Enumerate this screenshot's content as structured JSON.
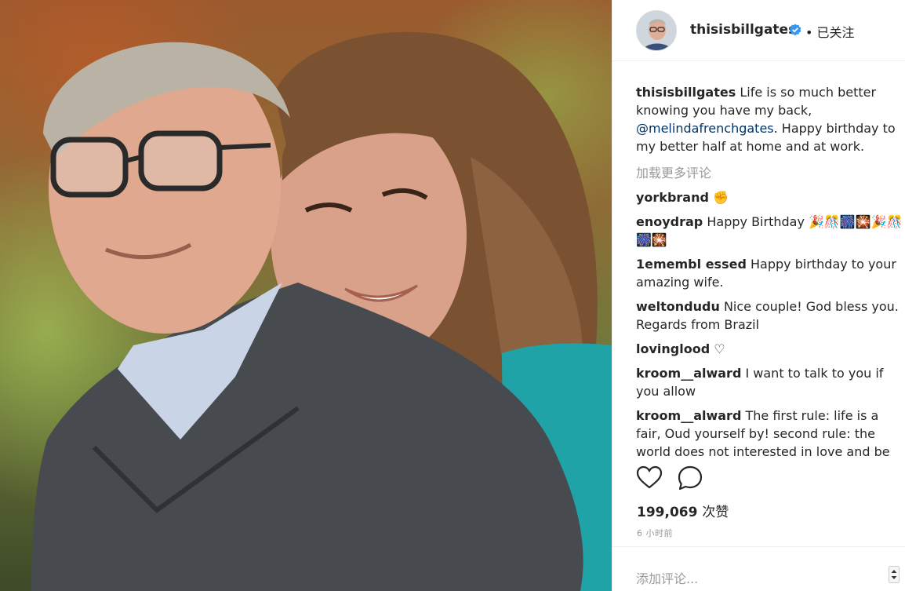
{
  "post": {
    "photo_alt": "Couple portrait"
  },
  "header": {
    "username": "thisisbillgates",
    "follow_status": "• 已关注"
  },
  "caption": {
    "username": "thisisbillgates",
    "text_before": "Life is so much better knowing you have my back, ",
    "mention": "@melindafrenchgates",
    "text_after": ". Happy birthday to my better half at home and at work."
  },
  "load_more_label": "加载更多评论",
  "comments": [
    {
      "username": "yorkbrand",
      "text": "✊"
    },
    {
      "username": "enoydrap",
      "text": "Happy Birthday 🎉🎊🎆🎇🎉🎊🎆🎇"
    },
    {
      "username": "1emembl essed",
      "text": "Happy birthday to your amazing wife."
    },
    {
      "username": "weltondudu",
      "text": "Nice couple! God bless you. Regards from Brazil"
    },
    {
      "username": "lovinglood",
      "text": "♡"
    },
    {
      "username": "kroom__alward",
      "text": "I want to talk to you if you allow"
    },
    {
      "username": "kroom__alward",
      "text": "The first rule: life is a fair, Oud yourself by! second rule: the world does not interested in love and be you it is"
    }
  ],
  "likes": {
    "count": "199,069",
    "unit": "次赞"
  },
  "timestamp": "6 小时前",
  "add_comment_placeholder": "添加评论...",
  "icons": {
    "like": "heart-outline-icon",
    "comment": "speech-bubble-icon",
    "verified": "verified-badge-icon"
  },
  "colors": {
    "verified_blue": "#3897f0",
    "mention_blue": "#003569",
    "muted_gray": "#999999",
    "text": "#262626"
  }
}
